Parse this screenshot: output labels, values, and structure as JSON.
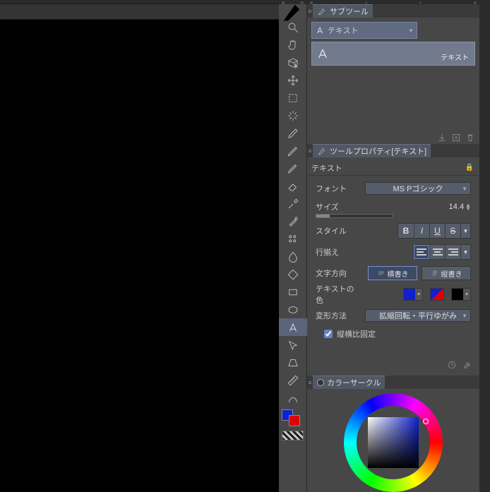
{
  "canvas": {},
  "toolbar": {
    "tools": [
      "magnify",
      "hand",
      "3d-cursor",
      "move",
      "marquee",
      "wand",
      "pen",
      "pencil",
      "brush",
      "eraser",
      "eyedropper",
      "color-mix",
      "bucket-pattern",
      "fill",
      "diamond",
      "rect",
      "ellipse",
      "text",
      "arrow-down",
      "perspective",
      "ruler-1",
      "ruler-2"
    ],
    "active": "text",
    "fg_color": "#1020d0",
    "bg_color": "#e00000"
  },
  "subtool": {
    "title": "サブツール",
    "select_label": "テキスト",
    "item_label": "テキスト"
  },
  "props": {
    "title": "ツールプロパティ[テキスト]",
    "header": "テキスト",
    "font_label": "フォント",
    "font_value": "MS Pゴシック",
    "size_label": "サイズ",
    "size_value": "14.4",
    "style_label": "スタイル",
    "style": {
      "bold": "B",
      "italic": "I",
      "underline": "U",
      "strike": "S"
    },
    "align_label": "行揃え",
    "dir_label": "文字方向",
    "dir_horiz": "横書き",
    "dir_vert": "縦書き",
    "color_label": "テキストの色",
    "transform_label": "変形方法",
    "transform_value": "拡縮回転・平行ゆがみ",
    "aspect_label": "縦横比固定"
  },
  "colorcircle": {
    "title": "カラーサークル"
  }
}
